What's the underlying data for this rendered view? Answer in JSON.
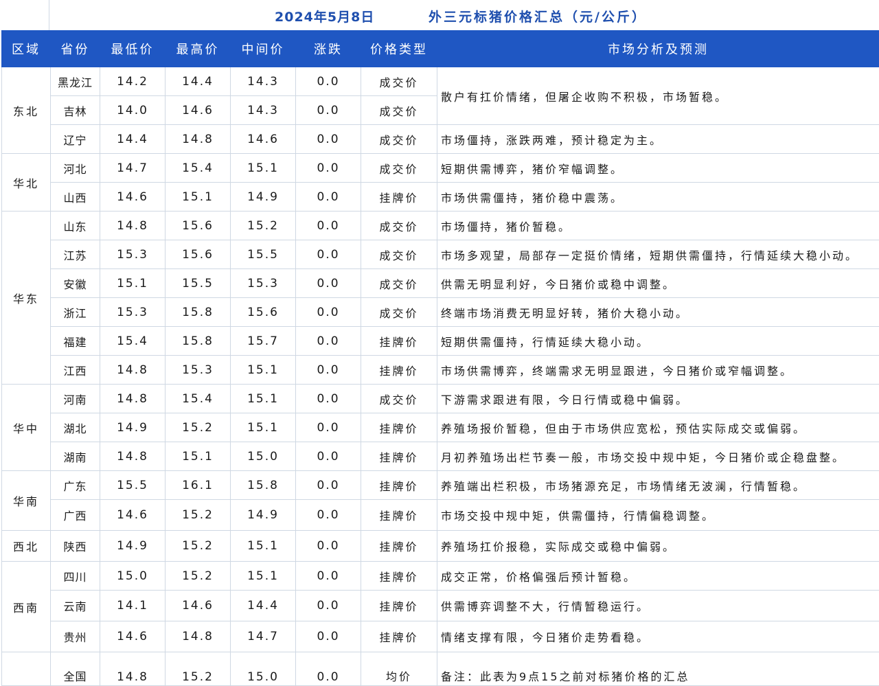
{
  "title": {
    "date": "2024年5月8日",
    "text": "外三元标猪价格汇总（元/公斤）"
  },
  "headers": [
    "区域",
    "省份",
    "最低价",
    "最高价",
    "中间价",
    "涨跌",
    "价格类型",
    "市场分析及预测"
  ],
  "regions": [
    {
      "name": "东北",
      "rows": [
        {
          "province": "黑龙江",
          "low": "14.2",
          "high": "14.4",
          "mid": "14.3",
          "change": "0.0",
          "type": "成交价",
          "analysis": "散户有扛价情绪，但屠企收购不积极，市场暂稳。",
          "span": 2
        },
        {
          "province": "吉林",
          "low": "14.0",
          "high": "14.6",
          "mid": "14.3",
          "change": "0.0",
          "type": "成交价",
          "analysis": null
        },
        {
          "province": "辽宁",
          "low": "14.4",
          "high": "14.8",
          "mid": "14.6",
          "change": "0.0",
          "type": "成交价",
          "analysis": "市场僵持，涨跌两难，预计稳定为主。"
        }
      ]
    },
    {
      "name": "华北",
      "rows": [
        {
          "province": "河北",
          "low": "14.7",
          "high": "15.4",
          "mid": "15.1",
          "change": "0.0",
          "type": "成交价",
          "analysis": "短期供需博弈，猪价窄幅调整。"
        },
        {
          "province": "山西",
          "low": "14.6",
          "high": "15.1",
          "mid": "14.9",
          "change": "0.0",
          "type": "挂牌价",
          "analysis": "市场供需僵持，猪价稳中震荡。"
        }
      ]
    },
    {
      "name": "华东",
      "rows": [
        {
          "province": "山东",
          "low": "14.8",
          "high": "15.6",
          "mid": "15.2",
          "change": "0.0",
          "type": "成交价",
          "analysis": "市场僵持，猪价暂稳。"
        },
        {
          "province": "江苏",
          "low": "15.3",
          "high": "15.6",
          "mid": "15.5",
          "change": "0.0",
          "type": "成交价",
          "analysis": "市场多观望，局部存一定挺价情绪，短期供需僵持，行情延续大稳小动。"
        },
        {
          "province": "安徽",
          "low": "15.1",
          "high": "15.5",
          "mid": "15.3",
          "change": "0.0",
          "type": "成交价",
          "analysis": "供需无明显利好，今日猪价或稳中调整。"
        },
        {
          "province": "浙江",
          "low": "15.3",
          "high": "15.8",
          "mid": "15.6",
          "change": "0.0",
          "type": "成交价",
          "analysis": "终端市场消费无明显好转，猪价大稳小动。"
        },
        {
          "province": "福建",
          "low": "15.4",
          "high": "15.8",
          "mid": "15.7",
          "change": "0.0",
          "type": "挂牌价",
          "analysis": "短期供需僵持，行情延续大稳小动。"
        },
        {
          "province": "江西",
          "low": "14.8",
          "high": "15.3",
          "mid": "15.1",
          "change": "0.0",
          "type": "挂牌价",
          "analysis": "市场供需博弈，终端需求无明显跟进，今日猪价或窄幅调整。"
        }
      ]
    },
    {
      "name": "华中",
      "rows": [
        {
          "province": "河南",
          "low": "14.8",
          "high": "15.4",
          "mid": "15.1",
          "change": "0.0",
          "type": "成交价",
          "analysis": "下游需求跟进有限，今日行情或稳中偏弱。"
        },
        {
          "province": "湖北",
          "low": "14.9",
          "high": "15.2",
          "mid": "15.1",
          "change": "0.0",
          "type": "挂牌价",
          "analysis": "养殖场报价暂稳，但由于市场供应宽松，预估实际成交或偏弱。"
        },
        {
          "province": "湖南",
          "low": "14.8",
          "high": "15.1",
          "mid": "15.0",
          "change": "0.0",
          "type": "挂牌价",
          "analysis": "月初养殖场出栏节奏一般，市场交投中规中矩，今日猪价或企稳盘整。"
        }
      ]
    },
    {
      "name": "华南",
      "rows": [
        {
          "province": "广东",
          "low": "15.5",
          "high": "16.1",
          "mid": "15.8",
          "change": "0.0",
          "type": "挂牌价",
          "analysis": "养殖端出栏积极，市场猪源充足，市场情绪无波澜，行情暂稳。"
        },
        {
          "province": "广西",
          "low": "14.6",
          "high": "15.2",
          "mid": "14.9",
          "change": "0.0",
          "type": "挂牌价",
          "analysis": "市场交投中规中矩，供需僵持，行情偏稳调整。"
        }
      ]
    },
    {
      "name": "西北",
      "rows": [
        {
          "province": "陕西",
          "low": "14.9",
          "high": "15.2",
          "mid": "15.1",
          "change": "0.0",
          "type": "挂牌价",
          "analysis": "养殖场扛价报稳，实际成交或稳中偏弱。"
        }
      ]
    },
    {
      "name": "西南",
      "rows": [
        {
          "province": "四川",
          "low": "15.0",
          "high": "15.2",
          "mid": "15.1",
          "change": "0.0",
          "type": "挂牌价",
          "analysis": "成交正常，价格偏强后预计暂稳。"
        },
        {
          "province": "云南",
          "low": "14.1",
          "high": "14.6",
          "mid": "14.4",
          "change": "0.0",
          "type": "挂牌价",
          "analysis": "供需博弈调整不大，行情暂稳运行。"
        },
        {
          "province": "贵州",
          "low": "14.6",
          "high": "14.8",
          "mid": "14.7",
          "change": "0.0",
          "type": "挂牌价",
          "analysis": "情绪支撑有限，今日猪价走势看稳。"
        }
      ]
    }
  ],
  "national": {
    "province": "全国",
    "low": "14.8",
    "high": "15.2",
    "mid": "15.0",
    "change": "0.0",
    "type": "均价",
    "analysis": "备注：此表为9点15之前对标猪价格的汇总"
  }
}
